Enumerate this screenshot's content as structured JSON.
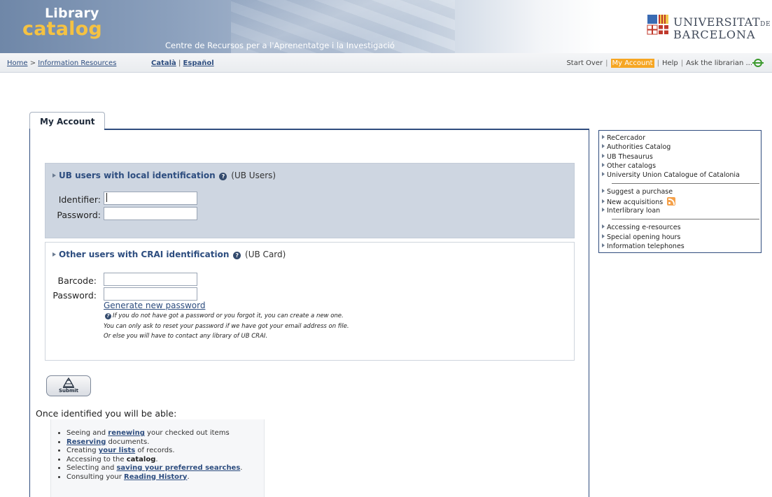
{
  "header": {
    "logo_top": "Library",
    "logo_bottom": "catalog",
    "subtitle": "Centre de Recursos per a l'Aprenentatge i la Investigació",
    "university_line1": "UNIVERSITAT",
    "university_de": "DE",
    "university_line2": "BARCELONA"
  },
  "navbar": {
    "breadcrumb_home": "Home",
    "breadcrumb_sep": " > ",
    "breadcrumb_current": "Information Resources",
    "lang_catala": "Català",
    "lang_sep": " | ",
    "lang_espanol": "Español",
    "start_over": "Start Over",
    "my_account": "My Account",
    "help": "Help",
    "ask_librarian": "Ask the librarian ...",
    "link_sep": "|"
  },
  "tab": {
    "label": "My Account"
  },
  "ub_users": {
    "title_strong": "UB users with local identification",
    "title_plain": "(UB Users)",
    "identifier_label": "Identifier:",
    "identifier_value": "",
    "password_label": "Password:",
    "password_value": ""
  },
  "other_users": {
    "title_strong": "Other users with CRAI identification",
    "title_plain": "(UB Card)",
    "barcode_label": "Barcode:",
    "barcode_value": "",
    "password_label": "Password:",
    "password_value": "",
    "generate_link": "Generate new password",
    "note_1": "If you do not have got a password or you forgot it, you can create a new one.",
    "note_2": "You can only ask to reset your password if we have got your email address on file.",
    "note_3": "Or else you will have to contact any library of UB CRAI."
  },
  "submit": {
    "label": "Submit"
  },
  "benefits": {
    "intro": "Once identified you will be able:",
    "b1_pre": "Seeing and ",
    "b1_link": "renewing",
    "b1_post": " your checked out items",
    "b2_link": "Reserving",
    "b2_post": " documents.",
    "b3_pre": "Creating ",
    "b3_link": "your lists",
    "b3_post": " of records.",
    "b4_pre": "Accessing to the ",
    "b4_bold": "catalog",
    "b4_post": ".",
    "b5_pre": "Selecting and ",
    "b5_link": "saving your preferred searches",
    "b5_post": ".",
    "b6_pre": "Consulting your ",
    "b6_link": "Reading History",
    "b6_post": "."
  },
  "sidebar": {
    "group1": [
      "ReCercador",
      "Authorities Catalog",
      "UB Thesaurus",
      "Other catalogs",
      "University Union Catalogue of Catalonia"
    ],
    "group2": [
      "Suggest a purchase",
      "New acquisitions",
      "Interlibrary loan"
    ],
    "group3": [
      "Accessing e-resources",
      "Special opening hours",
      "Information telephones"
    ]
  },
  "colors": {
    "accent_navy": "#2f4c7e",
    "link_blue": "#2d4d7f",
    "highlight_orange": "#f6a623",
    "logo_yellow": "#f5c242",
    "box_grey_blue": "#ced6e1"
  }
}
